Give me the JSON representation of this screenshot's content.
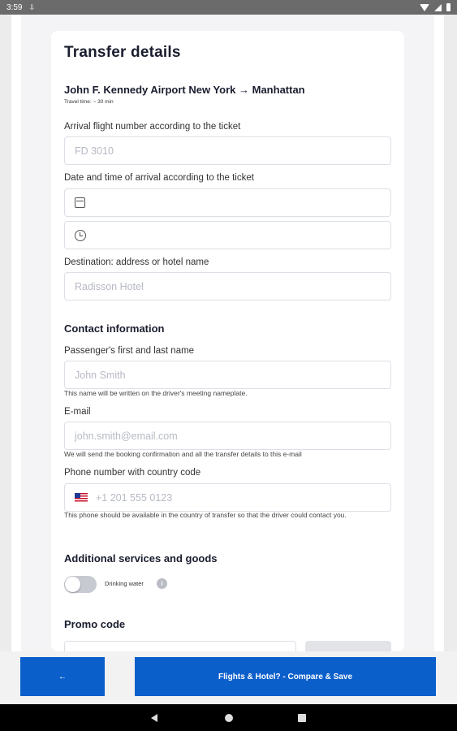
{
  "status_bar": {
    "time": "3:59",
    "download_glyph": "⇩"
  },
  "card": {
    "title": "Transfer details",
    "route": "John F. Kennedy Airport New York → Manhattan",
    "travel_time": "Travel time: ~ 30 min"
  },
  "form": {
    "flight_label": "Arrival flight number according to the ticket",
    "flight_placeholder": "FD 3010",
    "datetime_label": "Date and time of arrival according to the ticket",
    "destination_label": "Destination: address or hotel name",
    "destination_placeholder": "Radisson Hotel"
  },
  "contact": {
    "heading": "Contact information",
    "name_label": "Passenger's first and last name",
    "name_placeholder": "John Smith",
    "name_hint": "This name will be written on the driver's meeting nameplate.",
    "email_label": "E-mail",
    "email_placeholder": "john.smith@email.com",
    "email_hint": "We will send the booking confirmation and all the transfer details to this e-mail",
    "phone_label": "Phone number with country code",
    "phone_placeholder": "+1 201 555 0123",
    "phone_hint": "This phone should be available in the country of transfer so that the driver could contact you."
  },
  "extras": {
    "heading": "Additional services and goods",
    "drinking_water_label": "Drinking water",
    "drinking_water_enabled": false,
    "info_glyph": "i"
  },
  "promo": {
    "heading": "Promo code"
  },
  "bottom": {
    "back_label": "←",
    "cta_label": "Flights & Hotel? - Compare & Save"
  },
  "colors": {
    "primary": "#0b5fcb",
    "field_border": "#dcdfe6",
    "placeholder": "#b7bac4"
  }
}
